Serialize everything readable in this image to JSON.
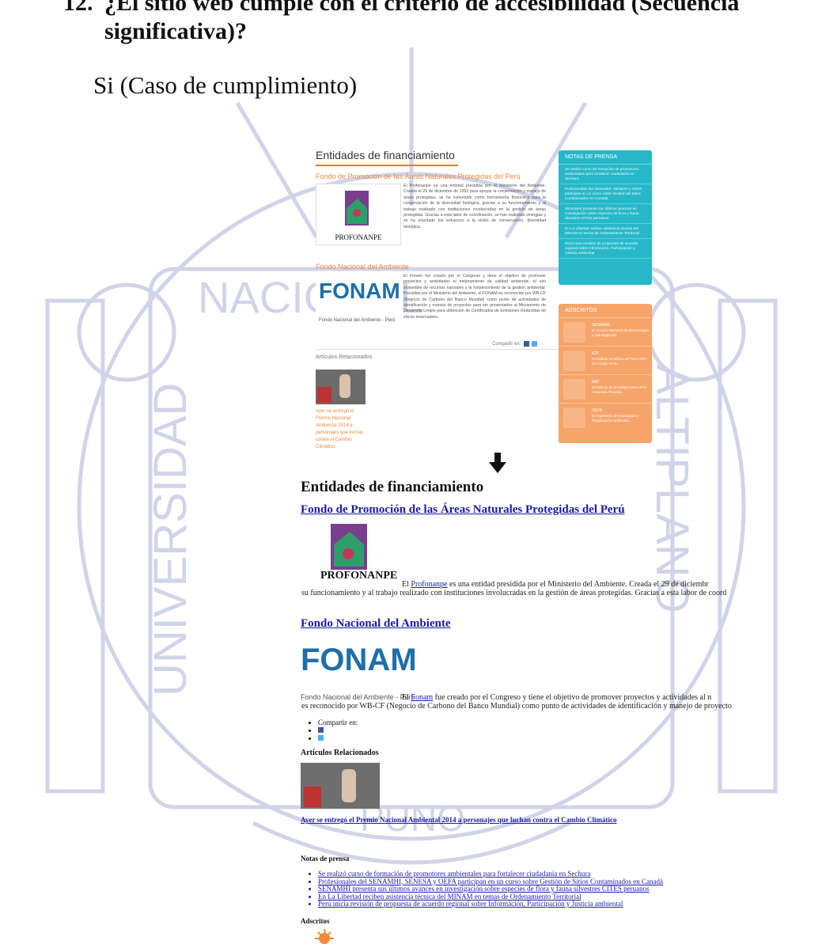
{
  "question": {
    "number": "12.",
    "text": "¿El sitio web cumple con el criterio de accesibilidad (Secuencia significativa)?"
  },
  "answer": "Si (Caso de cumplimiento)",
  "watermark": {
    "top_text": "NACIONAL",
    "left_text": "UNIVERSIDAD",
    "right_text": "ALTIPLANO",
    "bottom_text": "PUNO"
  },
  "styled_view": {
    "page_title": "Entidades de financiamiento",
    "section1_title": "Fondo de Promoción de las Áreas Naturales Protegidas del Perú",
    "section1_logo_text": "PROFONANPE",
    "section1_body": "El Profonanpe es una entidad presidida por el Ministerio del Ambiente. Creada el 29 de diciembre de 1992 para apoyar la conservación y manejo de áreas protegidas, se ha convertido como herramienta financiera para la conservación de la diversidad biológica, gracias a su funcionamiento y al trabajo realizado con instituciones involucradas en la gestión de áreas protegidas. Gracias a esta labor de coordinación, se han realizado sinergias y se ha orientado los esfuerzos a la visión de conservación, diversidad biológica.",
    "section2_title": "Fondo Nacional del Ambiente",
    "section2_logo_text": "FONAM",
    "section2_logo_caption": "Fondo Nacional del Ambiente - Perú",
    "section2_body": "El Fonam fue creado por el Congreso y tiene el objetivo de promover proyectos y actividades al mejoramiento de calidad ambiental, el uso sostenible de recursos naturales y la fortalecimiento de la gestión ambiental. Presidido por el Ministerio del Ambiente, el FONAM es reconocido por WB-CF (Negocio de Carbono del Banco Mundial) como punto de actividades de identificación y manejo de proyectos para ser presentados al Mecanismo de Desarrollo Limpio para obtención de Certificados de Emisiones Reducidas de efecto invernadero.",
    "share_label": "Compartir en:",
    "related_title": "Artículos Relacionados",
    "related_caption": "Ayer se entregó el Premio Nacional Ambiental 2014 a personajes que luchan contra el Cambio Climático",
    "notas_title": "NOTAS DE PRENSA",
    "notas_items": [
      "Se realizó curso de formación de promotores ambientales para fortalecer ciudadanía en Sechura",
      "Profesionales del SENAMHI, SENESA y OEFA participan en un curso sobre Gestión de Sitios Contaminados en Canadá",
      "SENAMHI presenta sus últimos avances en investigación sobre especies de flora y fauna silvestres CITES peruanos",
      "En La Libertad reciben asistencia técnica del MINAM en temas de Ordenamiento Territorial",
      "Perú inicia revisión de propuesta de acuerdo regional sobre Información, Participación y Justicia ambiental"
    ],
    "adscritos_title": "ADSCRITOS",
    "adscritos": [
      {
        "name": "SENAMHI",
        "desc": "El Servicio Nacional de Meteorología e Hidrología del..."
      },
      {
        "name": "IGP",
        "desc": "El Instituto Geofísico del Perú (IGP) fue creado en la..."
      },
      {
        "name": "IIAP",
        "desc": "El Instituto de Investigaciones de la Amazonía Peruana..."
      },
      {
        "name": "OEFA",
        "desc": "El Organismo de Evaluación y Fiscalización Ambiental..."
      }
    ]
  },
  "plain_view": {
    "page_title": "Entidades de financiamiento",
    "section1_title": "Fondo de Promoción de las Áreas Naturales Protegidas del Perú",
    "section1_logo_text": "PROFONANPE",
    "section1_line1_pre": "El ",
    "section1_link": "Profonanpe",
    "section1_line1_post": " es una entidad presidida por el Ministerio del Ambiente. Creada el 29 de diciembr",
    "section1_line2": "su funcionamiento y al trabajo realizado con instituciones involucradas en la gestión de áreas protegidas. Gracias a esta labor de coord",
    "section2_title": "Fondo Nacional del Ambiente",
    "section2_logo_text": "FONAM",
    "section2_logo_caption": "Fondo Nacional del Ambiente - Perú",
    "section2_line1_pre": "El ",
    "section2_link": "Fonam",
    "section2_line1_post": " fue creado por el Congreso y tiene el objetivo de promover proyectos y actividades al n",
    "section2_line2": "es reconocido por WB-CF (Negocio de Carbono del Banco Mundial) como punto de actividades de identificación y manejo de proyecto",
    "share_label": "Compartir en:",
    "related_title": "Artículos Relacionados",
    "related_link": "Ayer se entregó el Premio Nacional Ambiental 2014 a personajes que luchan contra el Cambio Climático",
    "notas_title": "Notas de prensa",
    "notas_items": [
      "Se realizó curso de formación de promotores ambientales para fortalecer ciudadanía en Sechura",
      "Profesionales del SENAMHI, SENESA y OEFA participan en un curso sobre Gestión de Sitios Contaminados en Canadá",
      "SENAMHI presenta sus últimos avances en investigación sobre especies de flora y fauna silvestres CITES peruanos",
      "En La Libertad reciben asistencia técnica del MINAM en temas de Ordenamiento Territorial",
      "Perú inicia revisión de propuesta de acuerdo regional sobre Información, Participación y Justicia ambiental"
    ],
    "adscritos_title": "Adscritos"
  },
  "colors": {
    "accent_orange": "#f08a3c",
    "teal_panel": "#26b8c9",
    "orange_panel": "#f5a46a",
    "link_blue": "#1a1aa8",
    "seal_blue": "#2c3e9a"
  }
}
